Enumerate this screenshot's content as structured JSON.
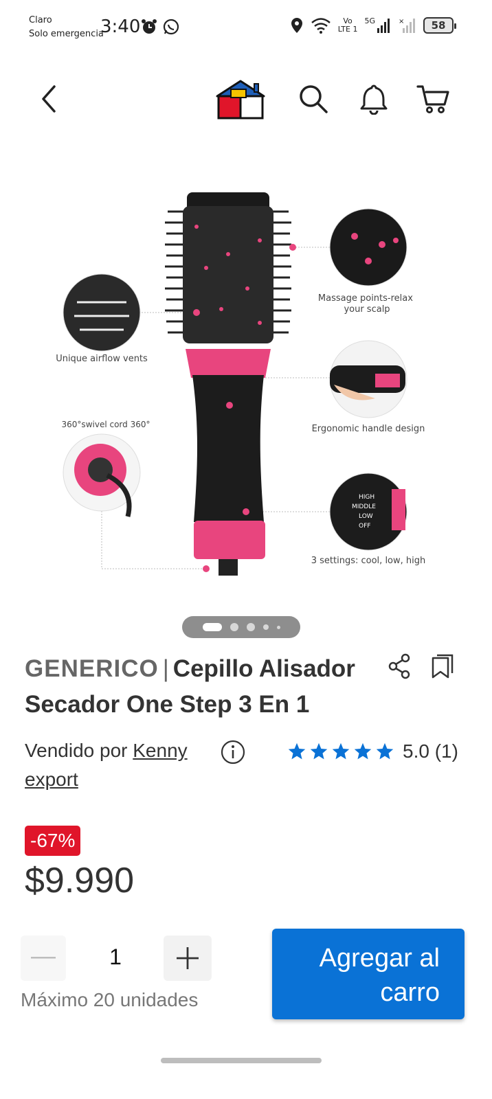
{
  "status_bar": {
    "carrier_line1": "Claro",
    "carrier_line2": "Solo emergencia",
    "time": "3:40",
    "net_vo": "Vo",
    "net_lte": "LTE 1",
    "net_5g": "5G",
    "battery": "58"
  },
  "header": {
    "back_icon": "chevron-left-icon",
    "logo_icon": "house-logo-icon",
    "search_icon": "search-icon",
    "bell_icon": "bell-icon",
    "cart_icon": "cart-icon"
  },
  "gallery": {
    "image_labels": {
      "massage": "Massage points-relax your scalp",
      "airflow": "Unique airflow vents",
      "swivel": "360°swivel cord  360°",
      "ergonomic": "Ergonomic handle design",
      "settings": "3 settings: cool, low, high",
      "setting_high": "HIGH",
      "setting_middle": "MIDDLE",
      "setting_low": "LOW",
      "setting_off": "OFF"
    },
    "pages": 5,
    "active_page": 1
  },
  "product": {
    "brand": "GENERICO",
    "separator": "|",
    "name": "Cepillo Alisador Secador One Step 3 En 1",
    "sold_by_label": "Vendido por",
    "seller_name": "Kenny export",
    "rating": 5.0,
    "rating_text": "5.0 (1)",
    "stars": 5,
    "discount": "-67%",
    "price": "$9.990"
  },
  "quantity": {
    "value": "1",
    "max_label": "Máximo 20 unidades"
  },
  "actions": {
    "add_to_cart": "Agregar al carro"
  },
  "colors": {
    "primary_blue": "#0a72d6",
    "discount_red": "#e0152a",
    "star_blue": "#0a72d6",
    "brush_pink": "#e8457e"
  }
}
